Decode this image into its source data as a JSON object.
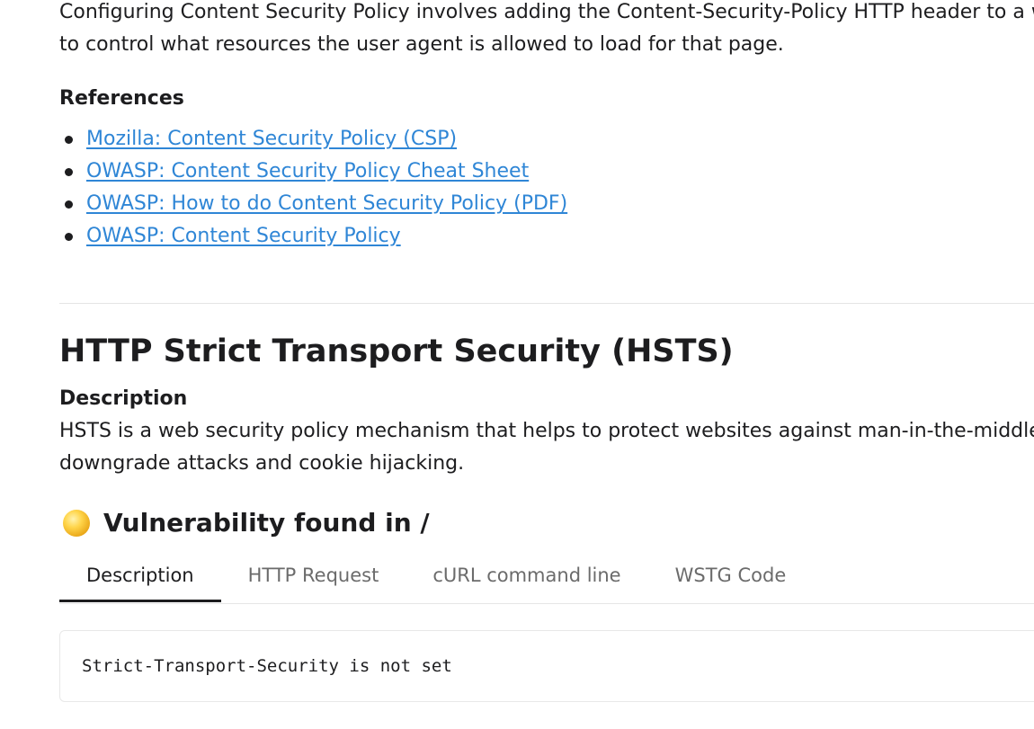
{
  "intro": {
    "line1": "Configuring Content Security Policy involves adding the Content-Security-Policy HTTP header to a web",
    "line2": "to control what resources the user agent is allowed to load for that page."
  },
  "references": {
    "heading": "References",
    "links": [
      {
        "label": "Mozilla: Content Security Policy (CSP)"
      },
      {
        "label": "OWASP: Content Security Policy Cheat Sheet"
      },
      {
        "label": "OWASP: How to do Content Security Policy (PDF)"
      },
      {
        "label": "OWASP: Content Security Policy"
      }
    ]
  },
  "section": {
    "title": "HTTP Strict Transport Security (HSTS)",
    "description_heading": "Description",
    "description_line1": "HSTS is a web security policy mechanism that helps to protect websites against man-in-the-middle atta",
    "description_line2": "downgrade attacks and cookie hijacking.",
    "severity_icon": "yellow-circle-icon",
    "severity_color": "#f2b92a",
    "vulnerability_title": "Vulnerability found in /"
  },
  "tabs": {
    "items": [
      {
        "label": "Description",
        "active": true
      },
      {
        "label": "HTTP Request",
        "active": false
      },
      {
        "label": "cURL command line",
        "active": false
      },
      {
        "label": "WSTG Code",
        "active": false
      }
    ]
  },
  "code": {
    "text": "Strict-Transport-Security is not set"
  },
  "colors": {
    "link": "#2f86d6",
    "text": "#1d1d1f",
    "tab_inactive": "#6b6b6b"
  }
}
